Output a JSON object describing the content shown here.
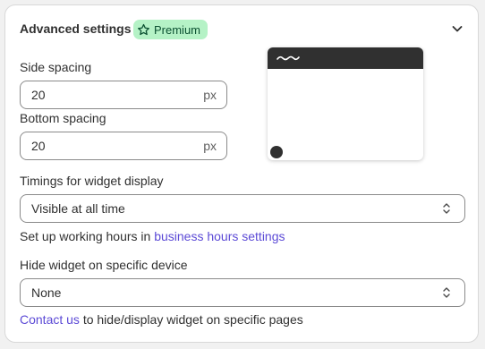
{
  "header": {
    "title": "Advanced settings",
    "badge": "Premium",
    "icons": {
      "badge": "star-icon",
      "toggle": "chevron-down-icon"
    }
  },
  "side_spacing": {
    "label": "Side spacing",
    "value": "20",
    "suffix": "px"
  },
  "bottom_spacing": {
    "label": "Bottom spacing",
    "value": "20",
    "suffix": "px"
  },
  "timings": {
    "label": "Timings for widget display",
    "selected": "Visible at all time",
    "help_prefix": "Set up working hours in ",
    "help_link": "business hours settings"
  },
  "device": {
    "label": "Hide widget on specific device",
    "selected": "None",
    "help_link": "Contact us",
    "help_suffix": " to hide/display widget on specific pages"
  },
  "colors": {
    "accent_link": "#5c4ad6",
    "badge_bg": "#b5f2c6",
    "badge_text": "#0c5132",
    "preview_dark": "#303030"
  }
}
